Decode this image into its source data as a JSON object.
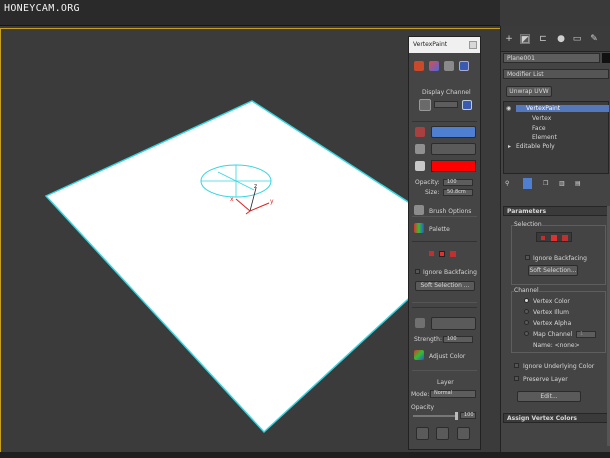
{
  "watermark": "HONEYCAM.ORG",
  "vertexpaint": {
    "title": "VertexPaint",
    "display_channel": "Display Channel",
    "opacity_label": "Opacity:",
    "opacity_value": "100",
    "size_label": "Size:",
    "size_value": "50.8cm",
    "brush_options": "Brush Options",
    "palette": "Palette",
    "ignore_backfacing": "Ignore Backfacing",
    "soft_selection": "Soft Selection ...",
    "strength_label": "Strength:",
    "strength_value": "100",
    "adjust_color": "Adjust Color",
    "layer": "Layer",
    "mode_label": "Mode:",
    "mode_value": "Normal",
    "layer_opacity_label": "Opacity",
    "layer_opacity_value": "100",
    "paint_color": "#ff0000"
  },
  "command_panel": {
    "object_name": "Plane001",
    "object_color": "#111111",
    "modifier_list": "Modifier List",
    "unwrap_button": "Unwrap UVW",
    "stack": [
      {
        "label": "VertexPaint",
        "selected": true
      },
      {
        "label": "Vertex",
        "selected": false
      },
      {
        "label": "Face",
        "selected": false
      },
      {
        "label": "Element",
        "selected": false
      },
      {
        "label": "Editable Poly",
        "selected": false
      }
    ],
    "parameters_title": "Parameters",
    "selection_title": "Selection",
    "ignore_backfacing": "Ignore Backfacing",
    "soft_selection": "Soft Selection...",
    "channel_title": "Channel",
    "channels": [
      "Vertex Color",
      "Vertex Illum",
      "Vertex Alpha",
      "Map Channel"
    ],
    "selected_channel": "Vertex Color",
    "map_channel_value": "1",
    "name_label": "Name: <none>",
    "ignore_underlying": "Ignore Underlying Color",
    "preserve_layer": "Preserve Layer",
    "edit_button": "Edit...",
    "assign_title": "Assign Vertex Colors"
  },
  "colors": {
    "plane_edge": "#33d6e0",
    "gizmo": "#33d6e0",
    "selection_accent": "#c8a020"
  }
}
